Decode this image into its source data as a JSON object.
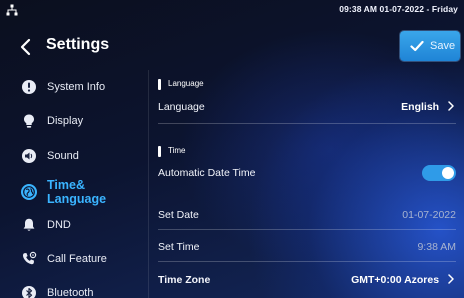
{
  "status_bar": {
    "network_icon": "network-tree-icon",
    "clock_text": "09:38 AM  01-07-2022 - Friday"
  },
  "header": {
    "back_icon": "chevron-left-icon",
    "title": "Settings",
    "save_icon": "checkmark-icon",
    "save_label": "Save"
  },
  "sidebar": {
    "items": [
      {
        "label": "System Info",
        "icon": "info-circle-icon",
        "active": false
      },
      {
        "label": "Display",
        "icon": "lightbulb-icon",
        "active": false
      },
      {
        "label": "Sound",
        "icon": "speaker-icon",
        "active": false
      },
      {
        "label_line1": "Time&",
        "label_line2": "Language",
        "icon": "globe-icon",
        "active": true
      },
      {
        "label": "DND",
        "icon": "bell-icon",
        "active": false
      },
      {
        "label": "Call Feature",
        "icon": "phone-settings-icon",
        "active": false
      },
      {
        "label": "Bluetooth",
        "icon": "bluetooth-icon",
        "active": false
      }
    ]
  },
  "main": {
    "language_section": {
      "header": "Language",
      "language_row": {
        "label": "Language",
        "value": "English"
      }
    },
    "time_section": {
      "header": "Time",
      "auto_datetime": {
        "label": "Automatic Date Time",
        "enabled": true
      },
      "set_date": {
        "label": "Set Date",
        "value": "01-07-2022"
      },
      "set_time": {
        "label": "Set Time",
        "value": "9:38 AM"
      },
      "time_zone": {
        "label": "Time Zone",
        "value": "GMT+0:00 Azores"
      }
    }
  },
  "colors": {
    "accent": "#3ab4ff",
    "save_button": "#2a95e0",
    "toggle_on": "#2f9be8",
    "disabled_value": "#a8b4d0"
  }
}
